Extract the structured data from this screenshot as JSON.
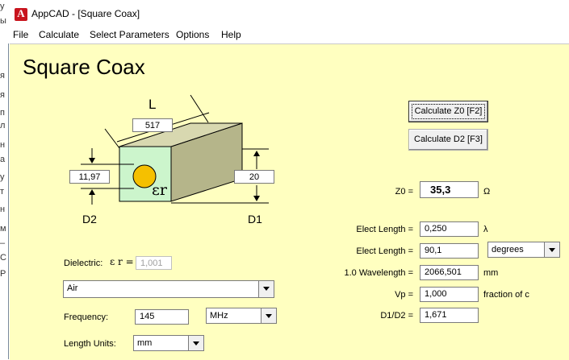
{
  "background_fragments": [
    "у",
    "ы",
    "я",
    "я",
    "п",
    "л",
    "н",
    "а",
    "у",
    "т",
    "н",
    "м",
    "–",
    "С",
    "Р"
  ],
  "window": {
    "title": "AppCAD - [Square Coax]",
    "icon_letter": "A"
  },
  "menu": [
    "File",
    "Calculate",
    "Select Parameters",
    "Options",
    "Help"
  ],
  "heading": "Square Coax",
  "diagram": {
    "label_L": "L",
    "L_value": "517",
    "d2_value": "11,97",
    "d1_value": "20",
    "er_label": "εr",
    "label_D2": "D2",
    "label_D1": "D1"
  },
  "buttons": {
    "calc_z0": "Calculate Z0  [F2]",
    "calc_d2": "Calculate D2  [F3]"
  },
  "results": {
    "z0_label": "Z0 =",
    "z0_value": "35,3",
    "z0_unit": "Ω",
    "elect_len_label": "Elect Length =",
    "elect_len_lambda": "0,250",
    "lambda_unit": "λ",
    "elect_len_deg": "90,1",
    "deg_unit": "degrees",
    "wavelength_label": "1.0 Wavelength =",
    "wavelength_value": "2066,501",
    "wavelength_unit": "mm",
    "vp_label": "Vp =",
    "vp_value": "1,000",
    "vp_unit": "fraction of c",
    "ratio_label": "D1/D2 =",
    "ratio_value": "1,671"
  },
  "inputs": {
    "dielectric_label": "Dielectric:",
    "er_symbol": "ε r =",
    "er_value": "1,001",
    "dielectric_material": "Air",
    "frequency_label": "Frequency:",
    "frequency_value": "145",
    "frequency_unit": "MHz",
    "length_units_label": "Length Units:",
    "length_units_value": "mm"
  },
  "colors": {
    "client_bg": "#ffffc0",
    "box_front": "#ccf5cc",
    "box_side": "#b5b58a",
    "center_conductor": "#f5c000"
  }
}
